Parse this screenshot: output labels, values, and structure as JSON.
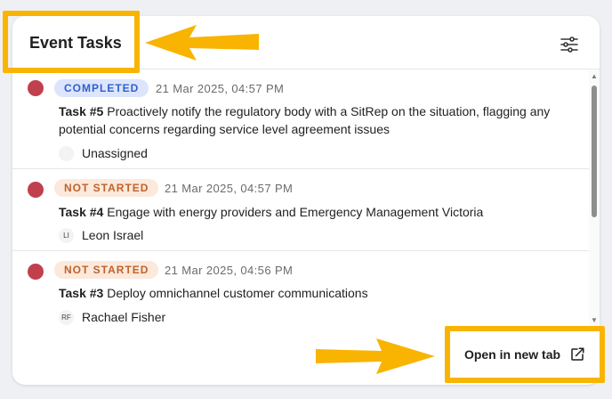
{
  "header": {
    "title": "Event Tasks"
  },
  "icons": {
    "filter": "sliders-icon",
    "external": "open-external-icon"
  },
  "colors": {
    "accent_highlight": "#f8b400",
    "status_dot": "#c0404d",
    "badge_completed_bg": "#dce5fb",
    "badge_completed_text": "#2f5fd0",
    "badge_notstarted_bg": "#fce9dc",
    "badge_notstarted_text": "#c0622a"
  },
  "tasks": [
    {
      "status": "COMPLETED",
      "timestamp": "21 Mar 2025, 04:57 PM",
      "number": "Task #5",
      "description": "Proactively notify the regulatory body with a SitRep on the situation, flagging any potential concerns regarding service level agreement issues",
      "assignee_initials": "",
      "assignee": "Unassigned"
    },
    {
      "status": "NOT STARTED",
      "timestamp": "21 Mar 2025, 04:57 PM",
      "number": "Task #4",
      "description": "Engage with energy providers and Emergency Management Victoria",
      "assignee_initials": "LI",
      "assignee": "Leon Israel"
    },
    {
      "status": "NOT STARTED",
      "timestamp": "21 Mar 2025, 04:56 PM",
      "number": "Task #3",
      "description": "Deploy omnichannel customer communications",
      "assignee_initials": "RF",
      "assignee": "Rachael Fisher"
    }
  ],
  "footer": {
    "open_label": "Open in new tab"
  }
}
